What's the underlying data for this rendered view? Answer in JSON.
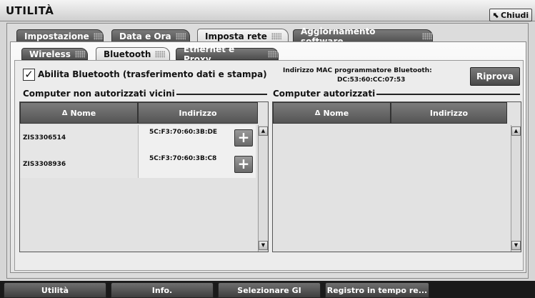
{
  "window": {
    "title": "UTILITÀ",
    "close_label": "Chiudi"
  },
  "main_tabs": [
    {
      "label": "Impostazione"
    },
    {
      "label": "Data e Ora"
    },
    {
      "label": "Imposta rete",
      "active": true
    },
    {
      "label": "Aggiornamento software"
    }
  ],
  "sub_tabs": [
    {
      "label": "Wireless"
    },
    {
      "label": "Bluetooth",
      "active": true
    },
    {
      "label": "Ethernet e Proxy"
    }
  ],
  "bluetooth": {
    "enable_label": "Abilita Bluetooth (trasferimento dati e stampa)",
    "enabled": true,
    "check_glyph": "✓",
    "mac_label": "Indirizzo MAC programmatore Bluetooth:",
    "mac_value": "DC:53:60:CC:07:53",
    "retry_label": "Riprova"
  },
  "unauthorized": {
    "title": "Computer non autorizzati vicini",
    "columns": {
      "name": "Nome",
      "address": "Indirizzo"
    },
    "rows": [
      {
        "name": "ZIS3306514",
        "address": "5C:F3:70:60:3B:DE"
      },
      {
        "name": "ZIS3308936",
        "address": "5C:F3:70:60:3B:C8"
      }
    ]
  },
  "authorized": {
    "title": "Computer autorizzati",
    "columns": {
      "name": "Nome",
      "address": "Indirizzo"
    },
    "rows": []
  },
  "icons": {
    "sort": "Δ",
    "add": "+",
    "scroll_up": "▲",
    "scroll_down": "▼",
    "close_arrow": "⬉"
  },
  "bottom_nav": [
    {
      "label": "Utilità"
    },
    {
      "label": "Info."
    },
    {
      "label": "Selezionare GI"
    },
    {
      "label": "Registro in tempo re..."
    }
  ]
}
